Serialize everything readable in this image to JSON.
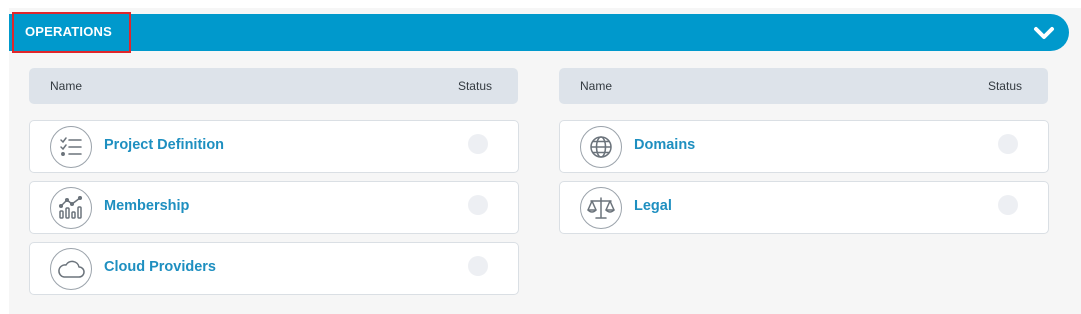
{
  "section": {
    "title": "OPERATIONS",
    "toggle_icon": "chevron-down-icon",
    "accent_color": "#0099cc",
    "highlight_color": "#e0262b"
  },
  "columns": {
    "name_label": "Name",
    "status_label": "Status"
  },
  "left_items": [
    {
      "label": "Project Definition",
      "icon": "checklist-icon"
    },
    {
      "label": "Membership",
      "icon": "analytics-icon"
    },
    {
      "label": "Cloud Providers",
      "icon": "cloud-icon"
    }
  ],
  "right_items": [
    {
      "label": "Domains",
      "icon": "globe-icon"
    },
    {
      "label": "Legal",
      "icon": "scales-icon"
    }
  ]
}
